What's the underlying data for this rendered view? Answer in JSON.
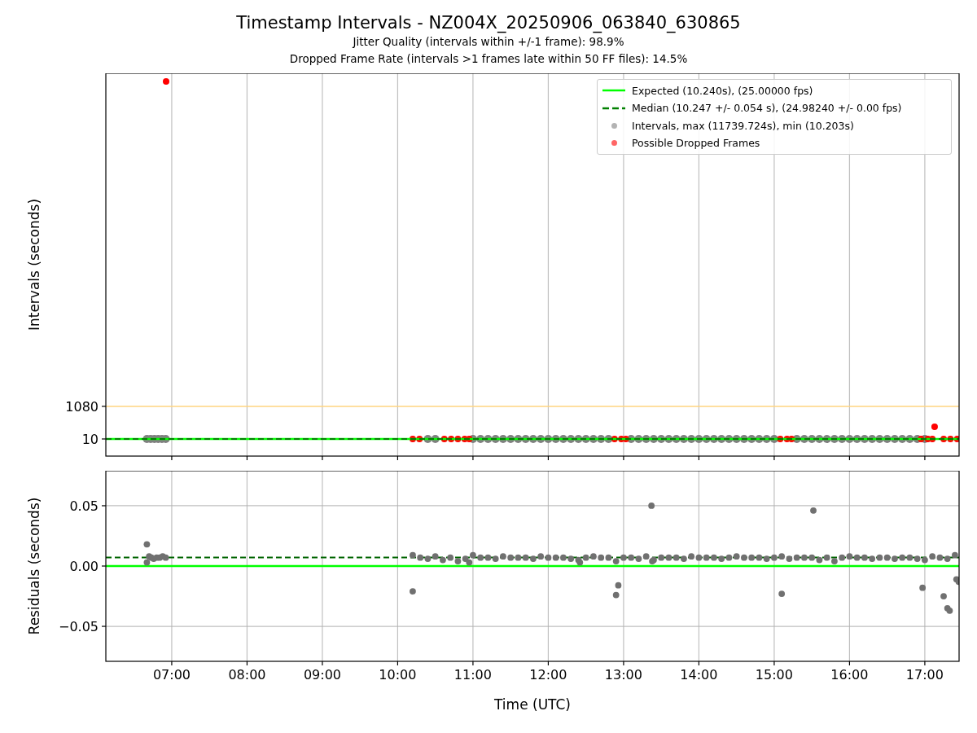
{
  "title": "Timestamp Intervals - NZ004X_20250906_063840_630865",
  "subtitles": [
    "Jitter Quality (intervals within +/-1 frame): 98.9%",
    "Dropped Frame Rate (intervals >1 frames late within 50 FF files): 14.5%"
  ],
  "panels": [
    {
      "chart_data": {
        "type": "scatter",
        "ylabel": "Intervals (seconds)",
        "xlim": [
          6.125,
          17.455
        ],
        "ylim": [
          -552,
          12010
        ],
        "grid": "x",
        "yticks": [
          {
            "value": 10,
            "label": "10"
          },
          {
            "value": 1080,
            "label": "1080"
          }
        ],
        "series": [
          {
            "type": "line",
            "color": "#ffd480",
            "x": [
              6.125,
              17.455
            ],
            "values": [
              1080,
              1080
            ]
          },
          {
            "name": "Expected (10.240s), (25.00000 fps)",
            "type": "line",
            "color": "#00ff00",
            "x": [
              6.125,
              17.455
            ],
            "values": [
              10,
              10
            ]
          },
          {
            "name": "Median (10.247 +/- 0.054 s), (24.98240 +/- 0.00 fps)",
            "type": "line",
            "line_style": "dashed",
            "color": "#008000",
            "x": [
              6.125,
              17.455
            ],
            "values": [
              10,
              10
            ]
          },
          {
            "name": "Intervals, max (11739.724s), min (10.203s)",
            "type": "scatter",
            "color": "#808080",
            "x": [
              6.67,
              6.72,
              6.77,
              6.82,
              6.87,
              6.92,
              10.4,
              10.5,
              11.0,
              11.1,
              11.2,
              11.3,
              11.4,
              11.5,
              11.6,
              11.7,
              11.8,
              11.9,
              12.0,
              12.1,
              12.2,
              12.3,
              12.4,
              12.5,
              12.6,
              12.7,
              12.8,
              13.1,
              13.2,
              13.3,
              13.4,
              13.5,
              13.6,
              13.7,
              13.8,
              13.9,
              14.0,
              14.1,
              14.2,
              14.3,
              14.4,
              14.5,
              14.6,
              14.7,
              14.8,
              14.9,
              15.0,
              15.3,
              15.4,
              15.5,
              15.6,
              15.7,
              15.8,
              15.9,
              16.0,
              16.1,
              16.2,
              16.3,
              16.4,
              16.5,
              16.6,
              16.7,
              16.8,
              16.9,
              17.0
            ],
            "values": [
              10,
              10,
              10,
              10,
              10,
              10,
              10,
              10,
              10,
              10,
              10,
              10,
              10,
              10,
              10,
              10,
              10,
              10,
              10,
              10,
              10,
              10,
              10,
              10,
              10,
              10,
              10,
              10,
              10,
              10,
              10,
              10,
              10,
              10,
              10,
              10,
              10,
              10,
              10,
              10,
              10,
              10,
              10,
              10,
              10,
              10,
              10,
              10,
              10,
              10,
              10,
              10,
              10,
              10,
              10,
              10,
              10,
              10,
              10,
              10,
              10,
              10,
              10,
              10,
              10
            ]
          },
          {
            "name": "Possible Dropped Frames",
            "type": "scatter",
            "color": "#ff0000",
            "x": [
              6.925,
              10.2,
              10.29,
              10.62,
              10.71,
              10.8,
              10.89,
              10.95,
              12.88,
              12.97,
              13.03,
              15.08,
              15.17,
              15.23,
              16.95,
              17.04,
              17.1,
              17.13,
              17.25,
              17.34,
              17.43
            ],
            "values": [
              11740,
              10,
              10,
              10,
              10,
              10,
              10,
              10,
              10,
              10,
              10,
              10,
              10,
              10,
              10,
              10,
              10,
              410,
              10,
              10,
              10
            ]
          }
        ]
      }
    },
    {
      "chart_data": {
        "type": "scatter",
        "xlabel": "Time (UTC)",
        "ylabel": "Residuals (seconds)",
        "xlim": [
          6.125,
          17.455
        ],
        "ylim": [
          -0.079,
          0.079
        ],
        "grid": "both",
        "xticks": [
          {
            "value": 7,
            "label": "07:00"
          },
          {
            "value": 8,
            "label": "08:00"
          },
          {
            "value": 9,
            "label": "09:00"
          },
          {
            "value": 10,
            "label": "10:00"
          },
          {
            "value": 11,
            "label": "11:00"
          },
          {
            "value": 12,
            "label": "12:00"
          },
          {
            "value": 13,
            "label": "13:00"
          },
          {
            "value": 14,
            "label": "14:00"
          },
          {
            "value": 15,
            "label": "15:00"
          },
          {
            "value": 16,
            "label": "16:00"
          },
          {
            "value": 17,
            "label": "17:00"
          }
        ],
        "yticks": [
          {
            "value": -0.05,
            "label": "−0.05"
          },
          {
            "value": 0,
            "label": "0.00"
          },
          {
            "value": 0.05,
            "label": "0.05"
          }
        ],
        "series": [
          {
            "type": "line",
            "color": "#00ff00",
            "x": [
              6.125,
              17.455
            ],
            "values": [
              0,
              0
            ]
          },
          {
            "type": "line",
            "line_style": "dashed",
            "color": "#006400",
            "x": [
              6.125,
              17.455
            ],
            "values": [
              0.007,
              0.007
            ]
          },
          {
            "type": "scatter",
            "color": "#707070",
            "x": [
              6.67,
              6.67,
              6.7,
              6.73,
              6.76,
              6.8,
              6.84,
              6.88,
              6.92,
              10.2,
              10.3,
              10.4,
              10.5,
              10.6,
              10.7,
              10.8,
              10.9,
              11.0,
              11.1,
              11.2,
              11.3,
              11.4,
              11.5,
              11.6,
              11.7,
              11.8,
              11.9,
              12.0,
              12.1,
              12.2,
              12.3,
              12.4,
              12.5,
              12.6,
              12.7,
              12.8,
              12.9,
              13.0,
              13.1,
              13.2,
              13.3,
              13.4,
              13.5,
              13.6,
              13.7,
              13.8,
              13.9,
              14.0,
              14.1,
              14.2,
              14.3,
              14.4,
              14.5,
              14.6,
              14.7,
              14.8,
              14.9,
              15.0,
              15.1,
              15.2,
              15.3,
              15.4,
              15.5,
              15.6,
              15.7,
              15.8,
              15.9,
              16.0,
              16.1,
              16.2,
              16.3,
              16.4,
              16.5,
              16.6,
              16.7,
              16.8,
              16.9,
              17.0,
              17.1,
              17.2,
              17.3,
              17.4,
              10.2,
              12.9,
              12.93,
              13.37,
              15.1,
              15.52,
              16.97,
              17.25,
              17.3,
              17.33,
              17.42,
              17.45,
              10.95,
              12.42,
              13.38
            ],
            "values": [
              0.018,
              0.003,
              0.008,
              0.007,
              0.006,
              0.007,
              0.007,
              0.008,
              0.007,
              0.009,
              0.007,
              0.006,
              0.008,
              0.005,
              0.007,
              0.004,
              0.006,
              0.009,
              0.007,
              0.007,
              0.006,
              0.008,
              0.007,
              0.007,
              0.007,
              0.006,
              0.008,
              0.007,
              0.007,
              0.007,
              0.006,
              0.005,
              0.007,
              0.008,
              0.007,
              0.007,
              0.004,
              0.007,
              0.007,
              0.006,
              0.008,
              0.005,
              0.007,
              0.007,
              0.007,
              0.006,
              0.008,
              0.007,
              0.007,
              0.007,
              0.006,
              0.007,
              0.008,
              0.007,
              0.007,
              0.007,
              0.006,
              0.007,
              0.008,
              0.006,
              0.007,
              0.007,
              0.007,
              0.005,
              0.007,
              0.004,
              0.007,
              0.008,
              0.007,
              0.007,
              0.006,
              0.007,
              0.007,
              0.006,
              0.007,
              0.007,
              0.006,
              0.005,
              0.008,
              0.007,
              0.006,
              0.009,
              -0.021,
              -0.024,
              -0.016,
              0.05,
              -0.023,
              0.046,
              -0.018,
              -0.025,
              -0.035,
              -0.037,
              -0.011,
              -0.013,
              0.003,
              0.003,
              0.004
            ]
          }
        ]
      }
    }
  ]
}
